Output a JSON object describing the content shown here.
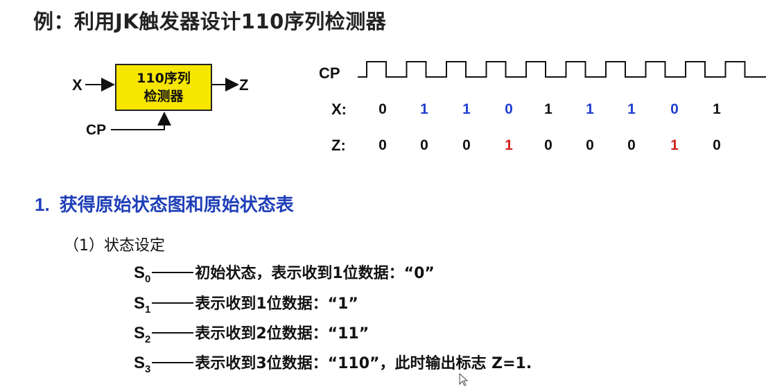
{
  "title": "例：利用JK触发器设计110序列检测器",
  "block": {
    "input_label": "X",
    "output_label": "Z",
    "clock_label": "CP",
    "box_line1": "110序列",
    "box_line2": "检测器",
    "box_color": "#f7e600"
  },
  "timing": {
    "cp_label": "CP",
    "x_label": "X:",
    "z_label": "Z:",
    "x_bits": [
      "0",
      "1",
      "1",
      "0",
      "1",
      "1",
      "1",
      "0",
      "1"
    ],
    "x_colors": [
      "black",
      "blue",
      "blue",
      "blue",
      "black",
      "blue",
      "blue",
      "blue",
      "black"
    ],
    "z_bits": [
      "0",
      "0",
      "0",
      "1",
      "0",
      "0",
      "0",
      "1",
      "0"
    ],
    "z_colors": [
      "black",
      "black",
      "black",
      "red",
      "black",
      "black",
      "black",
      "red",
      "black"
    ],
    "pulse_count": 10
  },
  "section": {
    "number": "1.",
    "title": "获得原始状态图和原始状态表"
  },
  "subsection": "（1）状态设定",
  "states": [
    {
      "name": "S",
      "sub": "0",
      "desc": "初始状态，表示收到1位数据：“0”"
    },
    {
      "name": "S",
      "sub": "1",
      "desc": "表示收到1位数据：“1”"
    },
    {
      "name": "S",
      "sub": "2",
      "desc": "表示收到2位数据：“11”"
    },
    {
      "name": "S",
      "sub": "3",
      "desc": "表示收到3位数据：“110”，此时输出标志 Z=1."
    }
  ],
  "colors": {
    "blue": "#1f3fd0",
    "red": "#d02020",
    "heading": "#1f3fb8"
  }
}
